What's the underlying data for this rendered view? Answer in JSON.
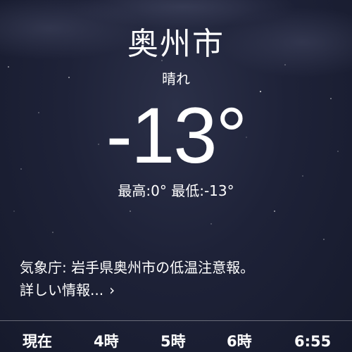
{
  "location": {
    "city": "奥州市",
    "condition": "晴れ",
    "temperature": "-13°"
  },
  "hilo": {
    "high": "最高:0°",
    "low": "最低:-13°"
  },
  "alert": {
    "text": "気象庁: 岩手県奥州市の低温注意報。",
    "more": "詳しい情報...",
    "chevron_icon": "chevron-right-icon"
  },
  "hourly": [
    {
      "label": "現在"
    },
    {
      "label": "4時"
    },
    {
      "label": "5時"
    },
    {
      "label": "6時"
    },
    {
      "label": "6:55"
    }
  ],
  "colors": {
    "background": "#1e2238",
    "text": "#ffffff"
  }
}
